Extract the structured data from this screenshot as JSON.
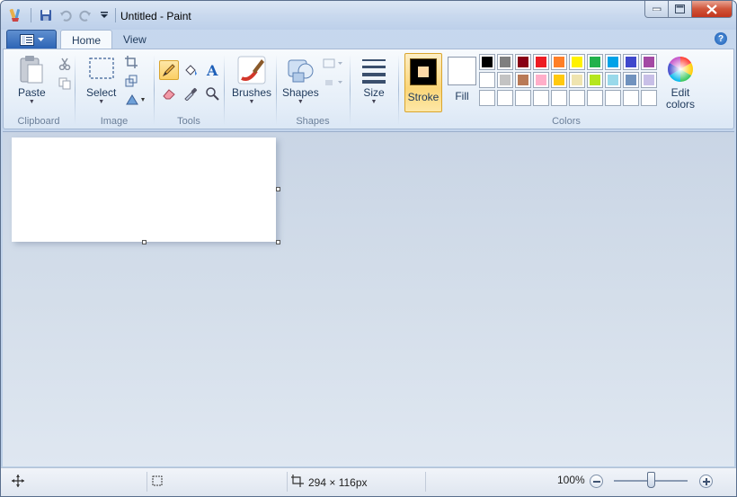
{
  "window": {
    "title": "Untitled - Paint",
    "controls": {
      "minimize": "minimize",
      "maximize": "maximize",
      "close": "close"
    }
  },
  "quick_access": {
    "icons": [
      "paint-app-icon",
      "save-icon",
      "undo-icon",
      "redo-icon",
      "customize-dropdown-icon"
    ]
  },
  "tabs": {
    "home": "Home",
    "view": "View",
    "active": "Home"
  },
  "ribbon": {
    "clipboard": {
      "label": "Clipboard",
      "paste": "Paste"
    },
    "image": {
      "label": "Image",
      "select": "Select"
    },
    "tools": {
      "label": "Tools",
      "active_tool": "pencil"
    },
    "brushes": {
      "label": "Brushes"
    },
    "shapes": {
      "label": "Shapes",
      "button": "Shapes"
    },
    "size": {
      "label": "Size"
    },
    "colors": {
      "label": "Colors",
      "stroke": "Stroke",
      "fill": "Fill",
      "edit_colors": "Edit colors",
      "stroke_color": "#fdd9a7",
      "palette_row1": [
        "#000000",
        "#7f7f7f",
        "#880015",
        "#ed1c24",
        "#ff7f27",
        "#fff200",
        "#22b14c",
        "#00a2e8",
        "#3f48cc",
        "#a349a4"
      ],
      "palette_row2": [
        "#ffffff",
        "#c3c3c3",
        "#b97a57",
        "#ffaec9",
        "#ffc90e",
        "#efe4b0",
        "#b5e61d",
        "#99d9ea",
        "#7092be",
        "#c8bfe7"
      ],
      "palette_row3": [
        "",
        "",
        "",
        "",
        "",
        "",
        "",
        "",
        "",
        ""
      ]
    }
  },
  "status": {
    "canvas_size": "294 × 116px",
    "zoom": "100%"
  }
}
